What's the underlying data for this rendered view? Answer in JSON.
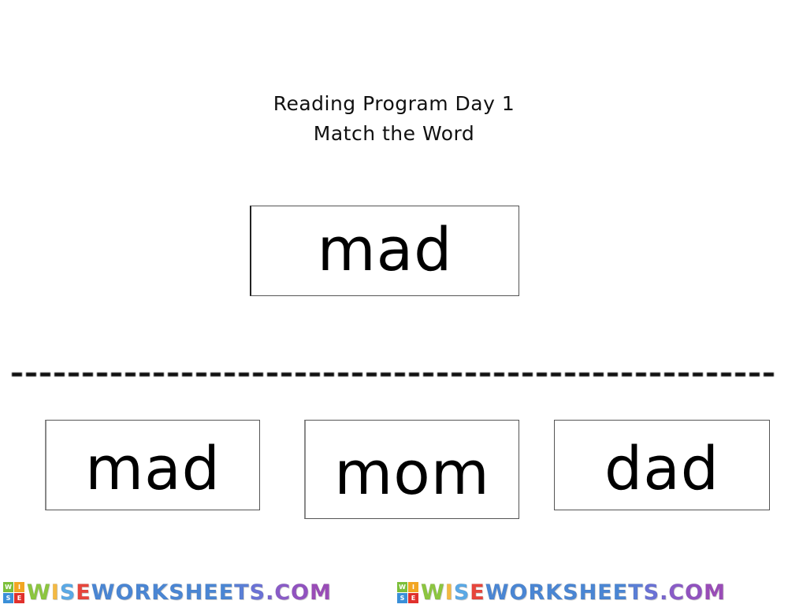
{
  "header": {
    "title": "Reading Program Day 1",
    "subtitle": "Match the Word"
  },
  "target_word": "mad",
  "options": [
    {
      "word": "mad"
    },
    {
      "word": "mom"
    },
    {
      "word": "dad"
    }
  ],
  "footer": {
    "logo_letters": [
      "W",
      "I",
      "S",
      "E"
    ],
    "logo_colors": [
      "#7cbf3a",
      "#f2a623",
      "#3a8fd8",
      "#e0302c"
    ],
    "brand_letters": [
      "W",
      "I",
      "S",
      "E",
      "W",
      "O",
      "R",
      "K",
      "S",
      "H",
      "E",
      "E",
      "T",
      "S",
      ".",
      "C",
      "O",
      "M"
    ],
    "brand_colors": [
      "#8cc63f",
      "#f4b942",
      "#5aa9e6",
      "#e8453c",
      "#4a86d4",
      "#4a86d4",
      "#4a86d4",
      "#4a86d4",
      "#4a86d4",
      "#4a86d4",
      "#4a86d4",
      "#4a86d4",
      "#5a7fd6",
      "#6a72d6",
      "#7a66d0",
      "#8a5cc8",
      "#9152c0",
      "#9a4cb8"
    ],
    "repeat": 2
  }
}
